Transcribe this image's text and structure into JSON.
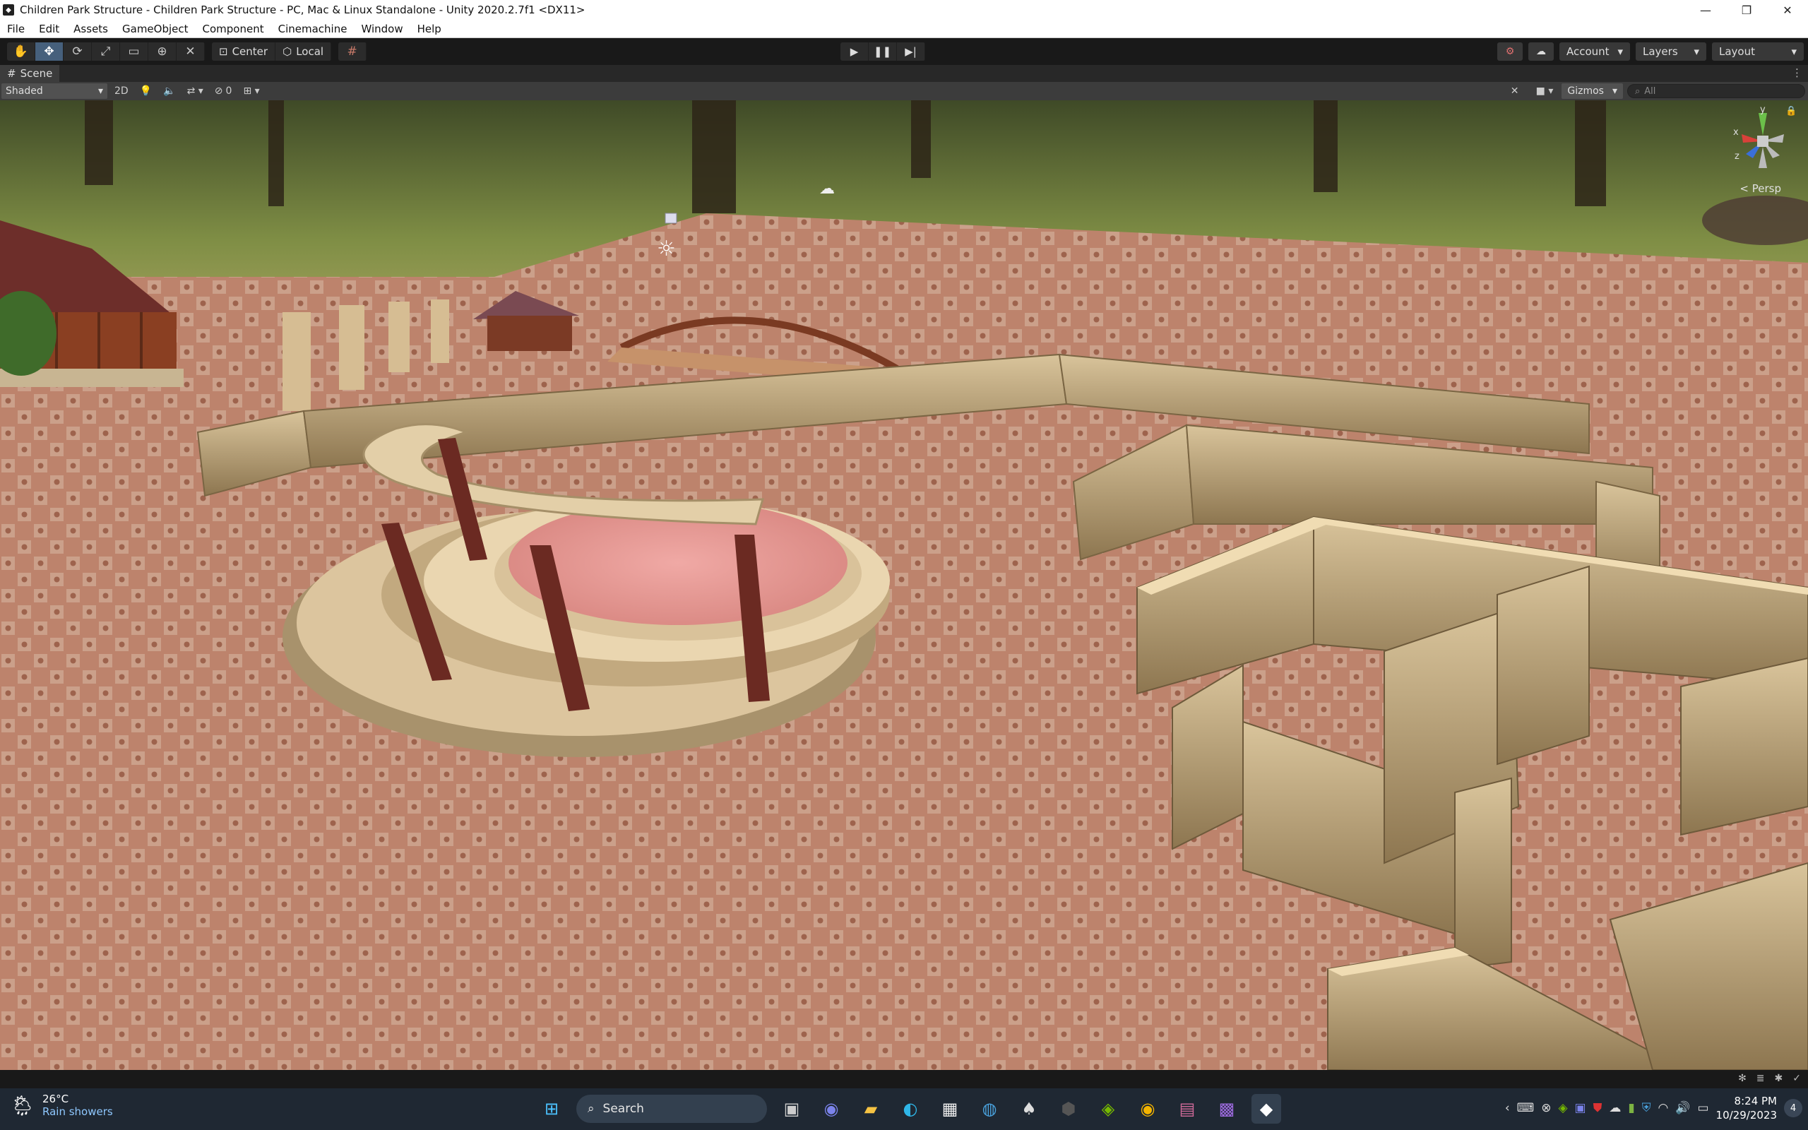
{
  "window": {
    "title": "Children Park Structure - Children Park Structure - PC, Mac & Linux Standalone - Unity 2020.2.7f1 <DX11>"
  },
  "menu": [
    "File",
    "Edit",
    "Assets",
    "GameObject",
    "Component",
    "Cinemachine",
    "Window",
    "Help"
  ],
  "toolbar": {
    "pivot_label": "Center",
    "space_label": "Local",
    "account_label": "Account",
    "layers_label": "Layers",
    "layout_label": "Layout"
  },
  "scene": {
    "tab_label": "Scene",
    "shading_mode": "Shaded",
    "mode_2d_label": "2D",
    "hidden_count": "0",
    "gizmos_label": "Gizmos",
    "search_placeholder": "All",
    "camera_label": "< Persp",
    "axis_labels": {
      "x": "x",
      "y": "y",
      "z": "z"
    }
  },
  "taskbar": {
    "weather_temp": "26°C",
    "weather_desc": "Rain showers",
    "search_label": "Search",
    "time": "8:24 PM",
    "date": "10/29/2023",
    "notification_count": "4"
  },
  "colors": {
    "active_tool": "#46607c",
    "floor": "#c9927a",
    "wall": "#cdb48a",
    "stage": "#e39a97",
    "pillar": "#6b2a22"
  }
}
